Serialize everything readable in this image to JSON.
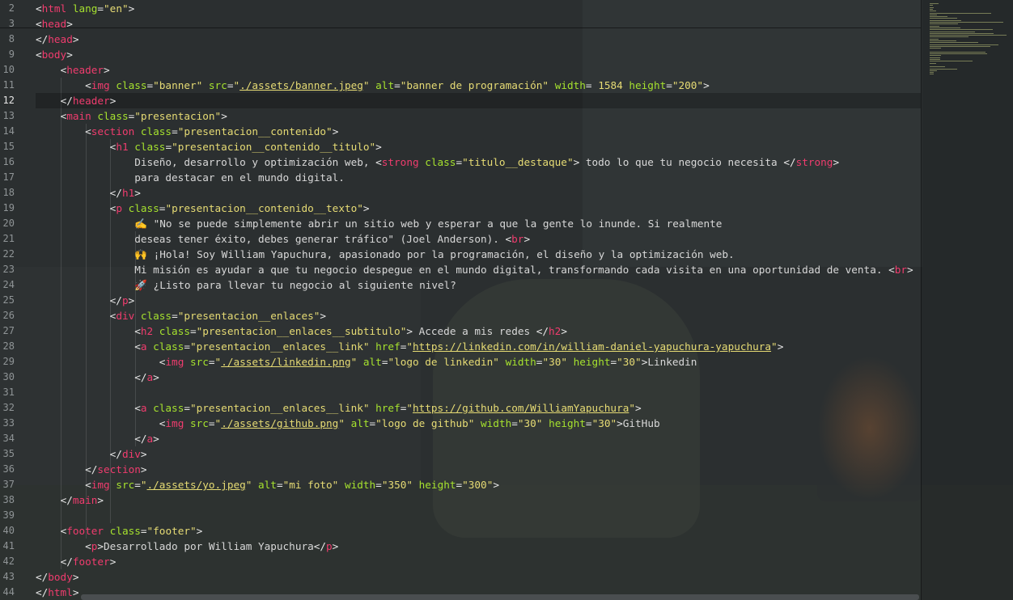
{
  "editor": {
    "lines": [
      {
        "n": "2",
        "tokens": [
          [
            "p",
            "<"
          ],
          [
            "t",
            "html"
          ],
          [
            "a",
            " lang"
          ],
          [
            "p",
            "="
          ],
          [
            "s",
            "\"en\""
          ],
          [
            "p",
            ">"
          ]
        ]
      },
      {
        "n": "3",
        "tokens": [
          [
            "p",
            "<"
          ],
          [
            "t",
            "head"
          ],
          [
            "p",
            ">"
          ]
        ]
      },
      {
        "n": "8",
        "tokens": [
          [
            "p",
            "</"
          ],
          [
            "t",
            "head"
          ],
          [
            "p",
            ">"
          ]
        ]
      },
      {
        "n": "9",
        "tokens": [
          [
            "p",
            "<"
          ],
          [
            "t",
            "body"
          ],
          [
            "p",
            ">"
          ]
        ]
      },
      {
        "n": "10",
        "tokens": [
          [
            "x",
            "    "
          ],
          [
            "p",
            "<"
          ],
          [
            "t",
            "header"
          ],
          [
            "p",
            ">"
          ]
        ]
      },
      {
        "n": "11",
        "tokens": [
          [
            "x",
            "        "
          ],
          [
            "p",
            "<"
          ],
          [
            "t",
            "img"
          ],
          [
            "a",
            " class"
          ],
          [
            "p",
            "="
          ],
          [
            "s",
            "\"banner\""
          ],
          [
            "a",
            " src"
          ],
          [
            "p",
            "="
          ],
          [
            "s",
            "\""
          ],
          [
            "u",
            "./assets/banner.jpeg"
          ],
          [
            "s",
            "\""
          ],
          [
            "a",
            " alt"
          ],
          [
            "p",
            "="
          ],
          [
            "s",
            "\"banner de programación\""
          ],
          [
            "a",
            " width"
          ],
          [
            "p",
            "= "
          ],
          [
            "s",
            "1584"
          ],
          [
            "a",
            " height"
          ],
          [
            "p",
            "="
          ],
          [
            "s",
            "\"200\""
          ],
          [
            "p",
            ">"
          ]
        ]
      },
      {
        "n": "12",
        "tokens": [
          [
            "x",
            "    "
          ],
          [
            "p",
            "</"
          ],
          [
            "t",
            "header"
          ],
          [
            "p",
            ">"
          ]
        ]
      },
      {
        "n": "13",
        "tokens": [
          [
            "x",
            "    "
          ],
          [
            "p",
            "<"
          ],
          [
            "t",
            "main"
          ],
          [
            "a",
            " class"
          ],
          [
            "p",
            "="
          ],
          [
            "s",
            "\"presentacion\""
          ],
          [
            "p",
            ">"
          ]
        ]
      },
      {
        "n": "14",
        "tokens": [
          [
            "x",
            "        "
          ],
          [
            "p",
            "<"
          ],
          [
            "t",
            "section"
          ],
          [
            "a",
            " class"
          ],
          [
            "p",
            "="
          ],
          [
            "s",
            "\"presentacion__contenido\""
          ],
          [
            "p",
            ">"
          ]
        ]
      },
      {
        "n": "15",
        "tokens": [
          [
            "x",
            "            "
          ],
          [
            "p",
            "<"
          ],
          [
            "t",
            "h1"
          ],
          [
            "a",
            " class"
          ],
          [
            "p",
            "="
          ],
          [
            "s",
            "\"presentacion__contenido__titulo\""
          ],
          [
            "p",
            ">"
          ]
        ]
      },
      {
        "n": "16",
        "tokens": [
          [
            "x",
            "                Diseño, desarrollo y optimización web, "
          ],
          [
            "p",
            "<"
          ],
          [
            "t",
            "strong"
          ],
          [
            "a",
            " class"
          ],
          [
            "p",
            "="
          ],
          [
            "s",
            "\"titulo__destaque\""
          ],
          [
            "p",
            ">"
          ],
          [
            "x",
            " todo lo que tu negocio necesita "
          ],
          [
            "p",
            "</"
          ],
          [
            "t",
            "strong"
          ],
          [
            "p",
            ">"
          ]
        ]
      },
      {
        "n": "17",
        "tokens": [
          [
            "x",
            "                para destacar en el mundo digital."
          ]
        ]
      },
      {
        "n": "18",
        "tokens": [
          [
            "x",
            "            "
          ],
          [
            "p",
            "</"
          ],
          [
            "t",
            "h1"
          ],
          [
            "p",
            ">"
          ]
        ]
      },
      {
        "n": "19",
        "tokens": [
          [
            "x",
            "            "
          ],
          [
            "p",
            "<"
          ],
          [
            "t",
            "p"
          ],
          [
            "a",
            " class"
          ],
          [
            "p",
            "="
          ],
          [
            "s",
            "\"presentacion__contenido__texto\""
          ],
          [
            "p",
            ">"
          ]
        ]
      },
      {
        "n": "20",
        "tokens": [
          [
            "x",
            "                ✍️ \"No se puede simplemente abrir un sitio web y esperar a que la gente lo inunde. Si realmente"
          ]
        ]
      },
      {
        "n": "21",
        "tokens": [
          [
            "x",
            "                deseas tener éxito, debes generar tráfico\" (Joel Anderson). "
          ],
          [
            "p",
            "<"
          ],
          [
            "t",
            "br"
          ],
          [
            "p",
            ">"
          ]
        ]
      },
      {
        "n": "22",
        "tokens": [
          [
            "x",
            "                🙌 ¡Hola! Soy William Yapuchura, apasionado por la programación, el diseño y la optimización web."
          ]
        ]
      },
      {
        "n": "23",
        "tokens": [
          [
            "x",
            "                Mi misión es ayudar a que tu negocio despegue en el mundo digital, transformando cada visita en una oportunidad de venta. "
          ],
          [
            "p",
            "<"
          ],
          [
            "t",
            "br"
          ],
          [
            "p",
            ">"
          ]
        ]
      },
      {
        "n": "24",
        "tokens": [
          [
            "x",
            "                🚀 ¿Listo para llevar tu negocio al siguiente nivel?"
          ]
        ]
      },
      {
        "n": "25",
        "tokens": [
          [
            "x",
            "            "
          ],
          [
            "p",
            "</"
          ],
          [
            "t",
            "p"
          ],
          [
            "p",
            ">"
          ]
        ]
      },
      {
        "n": "26",
        "tokens": [
          [
            "x",
            "            "
          ],
          [
            "p",
            "<"
          ],
          [
            "t",
            "div"
          ],
          [
            "a",
            " class"
          ],
          [
            "p",
            "="
          ],
          [
            "s",
            "\"presentacion__enlaces\""
          ],
          [
            "p",
            ">"
          ]
        ]
      },
      {
        "n": "27",
        "tokens": [
          [
            "x",
            "                "
          ],
          [
            "p",
            "<"
          ],
          [
            "t",
            "h2"
          ],
          [
            "a",
            " class"
          ],
          [
            "p",
            "="
          ],
          [
            "s",
            "\"presentacion__enlaces__subtitulo\""
          ],
          [
            "p",
            ">"
          ],
          [
            "x",
            " Accede a mis redes "
          ],
          [
            "p",
            "</"
          ],
          [
            "t",
            "h2"
          ],
          [
            "p",
            ">"
          ]
        ]
      },
      {
        "n": "28",
        "tokens": [
          [
            "x",
            "                "
          ],
          [
            "p",
            "<"
          ],
          [
            "t",
            "a"
          ],
          [
            "a",
            " class"
          ],
          [
            "p",
            "="
          ],
          [
            "s",
            "\"presentacion__enlaces__link\""
          ],
          [
            "a",
            " href"
          ],
          [
            "p",
            "="
          ],
          [
            "s",
            "\""
          ],
          [
            "u",
            "https://linkedin.com/in/william-daniel-yapuchura-yapuchura"
          ],
          [
            "s",
            "\""
          ],
          [
            "p",
            ">"
          ]
        ]
      },
      {
        "n": "29",
        "tokens": [
          [
            "x",
            "                    "
          ],
          [
            "p",
            "<"
          ],
          [
            "t",
            "img"
          ],
          [
            "a",
            " src"
          ],
          [
            "p",
            "="
          ],
          [
            "s",
            "\""
          ],
          [
            "u",
            "./assets/linkedin.png"
          ],
          [
            "s",
            "\""
          ],
          [
            "a",
            " alt"
          ],
          [
            "p",
            "="
          ],
          [
            "s",
            "\"logo de linkedin\""
          ],
          [
            "a",
            " width"
          ],
          [
            "p",
            "="
          ],
          [
            "s",
            "\"30\""
          ],
          [
            "a",
            " height"
          ],
          [
            "p",
            "="
          ],
          [
            "s",
            "\"30\""
          ],
          [
            "p",
            ">"
          ],
          [
            "x",
            "Linkedin"
          ]
        ]
      },
      {
        "n": "30",
        "tokens": [
          [
            "x",
            "                "
          ],
          [
            "p",
            "</"
          ],
          [
            "t",
            "a"
          ],
          [
            "p",
            ">"
          ]
        ]
      },
      {
        "n": "31",
        "tokens": []
      },
      {
        "n": "32",
        "tokens": [
          [
            "x",
            "                "
          ],
          [
            "p",
            "<"
          ],
          [
            "t",
            "a"
          ],
          [
            "a",
            " class"
          ],
          [
            "p",
            "="
          ],
          [
            "s",
            "\"presentacion__enlaces__link\""
          ],
          [
            "a",
            " href"
          ],
          [
            "p",
            "="
          ],
          [
            "s",
            "\""
          ],
          [
            "u",
            "https://github.com/WilliamYapuchura"
          ],
          [
            "s",
            "\""
          ],
          [
            "p",
            ">"
          ]
        ]
      },
      {
        "n": "33",
        "tokens": [
          [
            "x",
            "                    "
          ],
          [
            "p",
            "<"
          ],
          [
            "t",
            "img"
          ],
          [
            "a",
            " src"
          ],
          [
            "p",
            "="
          ],
          [
            "s",
            "\""
          ],
          [
            "u",
            "./assets/github.png"
          ],
          [
            "s",
            "\""
          ],
          [
            "a",
            " alt"
          ],
          [
            "p",
            "="
          ],
          [
            "s",
            "\"logo de github\""
          ],
          [
            "a",
            " width"
          ],
          [
            "p",
            "="
          ],
          [
            "s",
            "\"30\""
          ],
          [
            "a",
            " height"
          ],
          [
            "p",
            "="
          ],
          [
            "s",
            "\"30\""
          ],
          [
            "p",
            ">"
          ],
          [
            "x",
            "GitHub"
          ]
        ]
      },
      {
        "n": "34",
        "tokens": [
          [
            "x",
            "                "
          ],
          [
            "p",
            "</"
          ],
          [
            "t",
            "a"
          ],
          [
            "p",
            ">"
          ]
        ]
      },
      {
        "n": "35",
        "tokens": [
          [
            "x",
            "            "
          ],
          [
            "p",
            "</"
          ],
          [
            "t",
            "div"
          ],
          [
            "p",
            ">"
          ]
        ]
      },
      {
        "n": "36",
        "tokens": [
          [
            "x",
            "        "
          ],
          [
            "p",
            "</"
          ],
          [
            "t",
            "section"
          ],
          [
            "p",
            ">"
          ]
        ]
      },
      {
        "n": "37",
        "tokens": [
          [
            "x",
            "        "
          ],
          [
            "p",
            "<"
          ],
          [
            "t",
            "img"
          ],
          [
            "a",
            " src"
          ],
          [
            "p",
            "="
          ],
          [
            "s",
            "\""
          ],
          [
            "u",
            "./assets/yo.jpeg"
          ],
          [
            "s",
            "\""
          ],
          [
            "a",
            " alt"
          ],
          [
            "p",
            "="
          ],
          [
            "s",
            "\"mi foto\""
          ],
          [
            "a",
            " width"
          ],
          [
            "p",
            "="
          ],
          [
            "s",
            "\"350\""
          ],
          [
            "a",
            " height"
          ],
          [
            "p",
            "="
          ],
          [
            "s",
            "\"300\""
          ],
          [
            "p",
            ">"
          ]
        ]
      },
      {
        "n": "38",
        "tokens": [
          [
            "x",
            "    "
          ],
          [
            "p",
            "</"
          ],
          [
            "t",
            "main"
          ],
          [
            "p",
            ">"
          ]
        ]
      },
      {
        "n": "39",
        "tokens": []
      },
      {
        "n": "40",
        "tokens": [
          [
            "x",
            "    "
          ],
          [
            "p",
            "<"
          ],
          [
            "t",
            "footer"
          ],
          [
            "a",
            " class"
          ],
          [
            "p",
            "="
          ],
          [
            "s",
            "\"footer\""
          ],
          [
            "p",
            ">"
          ]
        ]
      },
      {
        "n": "41",
        "tokens": [
          [
            "x",
            "        "
          ],
          [
            "p",
            "<"
          ],
          [
            "t",
            "p"
          ],
          [
            "p",
            ">"
          ],
          [
            "x",
            "Desarrollado por William Yapuchura"
          ],
          [
            "p",
            "</"
          ],
          [
            "t",
            "p"
          ],
          [
            "p",
            ">"
          ]
        ]
      },
      {
        "n": "42",
        "tokens": [
          [
            "x",
            "    "
          ],
          [
            "p",
            "</"
          ],
          [
            "t",
            "footer"
          ],
          [
            "p",
            ">"
          ]
        ]
      },
      {
        "n": "43",
        "tokens": [
          [
            "p",
            "</"
          ],
          [
            "t",
            "body"
          ],
          [
            "p",
            ">"
          ]
        ]
      },
      {
        "n": "44",
        "tokens": [
          [
            "p",
            "</"
          ],
          [
            "t",
            "html"
          ],
          [
            "p",
            ">"
          ]
        ]
      }
    ],
    "current_line": "12"
  },
  "colors": {
    "tag": "#f03c6e",
    "attribute": "#a6e22e",
    "string": "#e6db74",
    "punctuation": "#e6e6e6",
    "text": "#d8d8d8"
  }
}
